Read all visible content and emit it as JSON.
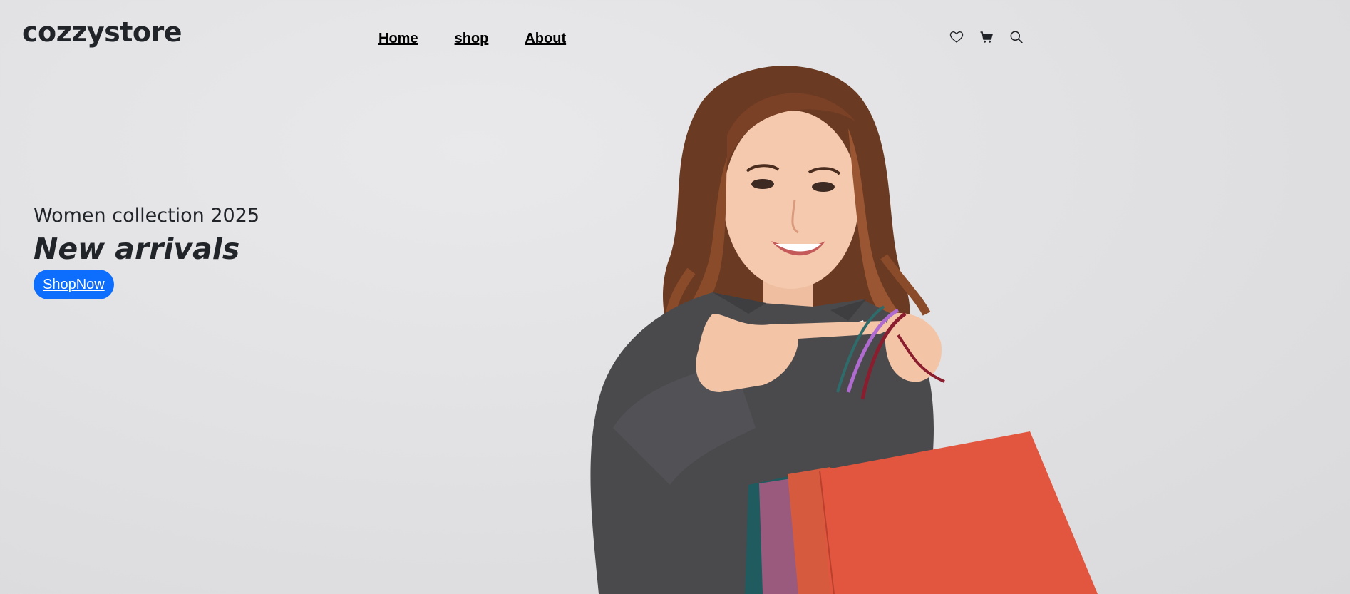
{
  "header": {
    "brand": "cozzystore",
    "nav": [
      {
        "label": "Home"
      },
      {
        "label": "shop"
      },
      {
        "label": "About"
      }
    ],
    "icons": [
      "heart-icon",
      "cart-icon",
      "search-icon"
    ]
  },
  "hero": {
    "subtitle": "Women collection 2025",
    "headline": "New arrivals",
    "cta_label": "ShopNow",
    "image_description_icon": "model-with-shopping-bags-image"
  },
  "colors": {
    "background": "#e3e3e5",
    "text": "#212529",
    "button": "#0d6efd",
    "button_text": "#ffffff"
  }
}
